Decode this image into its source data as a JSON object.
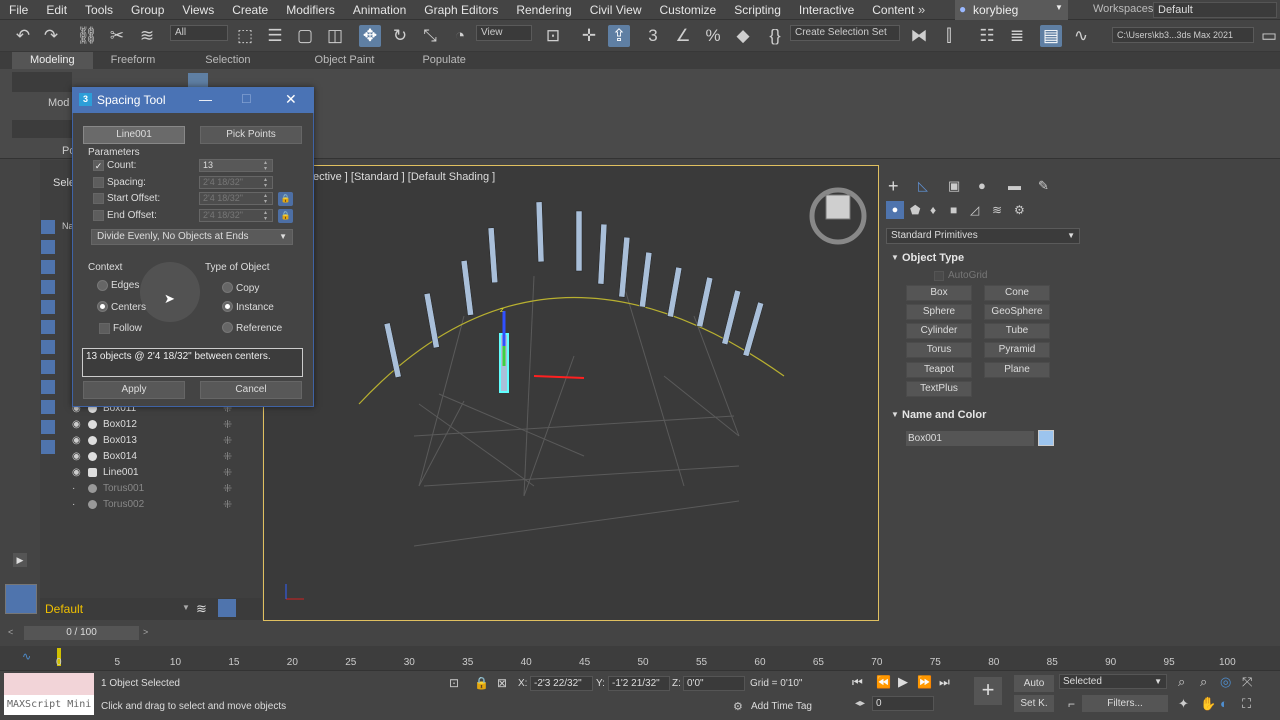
{
  "menu": [
    "File",
    "Edit",
    "Tools",
    "Group",
    "Views",
    "Create",
    "Modifiers",
    "Animation",
    "Graph Editors",
    "Rendering",
    "Civil View",
    "Customize",
    "Scripting",
    "Interactive",
    "Content"
  ],
  "user": "korybieg",
  "workspace": {
    "label": "Workspaces:",
    "value": "Default"
  },
  "toolbar": {
    "filter_value": "All",
    "view_value": "View",
    "selection_set": "Create Selection Set",
    "project_path": "C:\\Users\\kb3...3ds Max 2021"
  },
  "ribbon_tabs": [
    "Modeling",
    "Freeform",
    "Selection",
    "Object Paint",
    "Populate"
  ],
  "ribbon_partial": {
    "mod": "Mod",
    "po": "Po",
    "sele": "Sele",
    "na": "Na"
  },
  "dialog": {
    "title": "Spacing Tool",
    "path_button": "Line001",
    "pick_points_button": "Pick Points",
    "parameters_label": "Parameters",
    "count_label": "Count:",
    "count_value": "13",
    "spacing_label": "Spacing:",
    "spacing_value": "2'4 18/32\"",
    "start_offset_label": "Start Offset:",
    "start_offset_value": "2'4 18/32\"",
    "end_offset_label": "End Offset:",
    "end_offset_value": "2'4 18/32\"",
    "distribution": "Divide Evenly, No Objects at Ends",
    "context_label": "Context",
    "edges_label": "Edges",
    "centers_label": "Centers",
    "follow_label": "Follow",
    "type_label": "Type of Object",
    "copy_label": "Copy",
    "instance_label": "Instance",
    "reference_label": "Reference",
    "info": "13 objects @ 2'4 18/32\"  between centers.",
    "apply": "Apply",
    "cancel": "Cancel"
  },
  "scene_items": [
    {
      "name": "Box011",
      "dim": false
    },
    {
      "name": "Box012",
      "dim": false
    },
    {
      "name": "Box013",
      "dim": false
    },
    {
      "name": "Box014",
      "dim": false
    },
    {
      "name": "Line001",
      "dim": false
    },
    {
      "name": "Torus001",
      "dim": true
    },
    {
      "name": "Torus002",
      "dim": true
    }
  ],
  "layer": "Default",
  "viewport_label": "ective ] [Standard ] [Default Shading ]",
  "command_panel": {
    "category": "Standard Primitives",
    "object_type_title": "Object Type",
    "autogrid": "AutoGrid",
    "buttons": [
      "Box",
      "Cone",
      "Sphere",
      "GeoSphere",
      "Cylinder",
      "Tube",
      "Torus",
      "Pyramid",
      "Teapot",
      "Plane",
      "TextPlus"
    ],
    "name_color_title": "Name and Color",
    "object_name": "Box001",
    "object_color": "#9cc4ee"
  },
  "timeline": {
    "frame_display": "0 / 100",
    "ticks": [
      "0",
      "5",
      "10",
      "15",
      "20",
      "25",
      "30",
      "35",
      "40",
      "45",
      "50",
      "55",
      "60",
      "65",
      "70",
      "75",
      "80",
      "85",
      "90",
      "95",
      "100"
    ]
  },
  "status": {
    "maxscript": "MAXScript Mini",
    "selected": "1 Object Selected",
    "prompt": "Click and drag to select and move objects",
    "x_label": "X:",
    "x_value": "-2'3 22/32\"",
    "y_label": "Y:",
    "y_value": "-1'2 21/32\"",
    "z_label": "Z:",
    "z_value": "0'0\"",
    "grid": "Grid = 0'10\"",
    "add_time_tag": "Add Time Tag",
    "auto": "Auto",
    "set_key": "Set K.",
    "key_filter": "Selected",
    "filters": "Filters...",
    "current_frame": "0"
  }
}
